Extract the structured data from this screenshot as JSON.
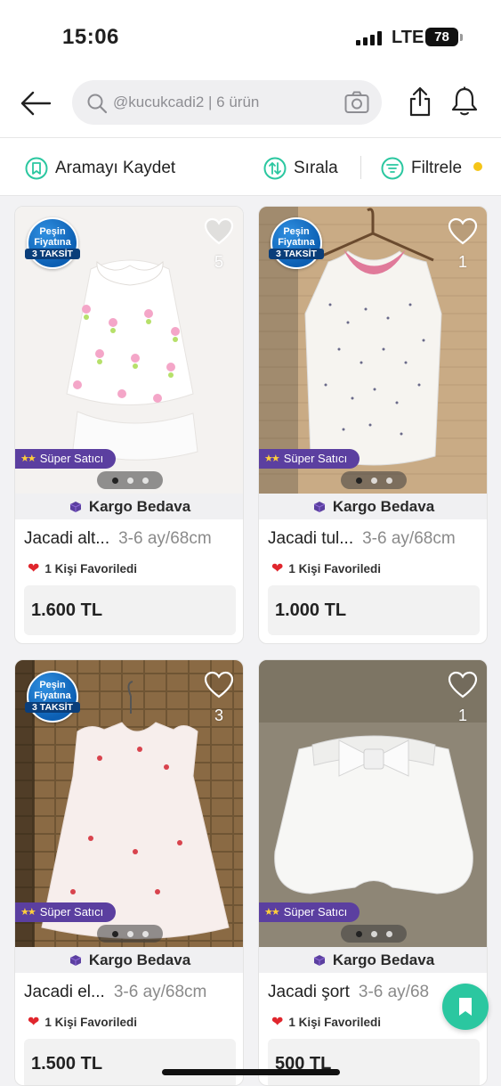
{
  "status_bar": {
    "time": "15:06",
    "network": "LTE",
    "battery": "78"
  },
  "header": {
    "search_placeholder": "@kucukcadi2 | 6 ürün"
  },
  "toolbar": {
    "save_search": "Aramayı Kaydet",
    "sort": "Sırala",
    "filter": "Filtrele"
  },
  "badges": {
    "taksit_line1": "Peşin",
    "taksit_line2": "Fiyatına",
    "taksit_line3": "3 TAKSİT",
    "super_seller": "Süper Satıcı",
    "free_shipping": "Kargo Bedava"
  },
  "products": [
    {
      "title": "Jacadi alt...",
      "size": "3-6 ay/68cm",
      "likes": "1 Kişi Favoriledi",
      "price": "1.600 TL",
      "fav_count": "5",
      "taksit_badge": true
    },
    {
      "title": "Jacadi tul...",
      "size": "3-6 ay/68cm",
      "likes": "1 Kişi Favoriledi",
      "price": "1.000 TL",
      "fav_count": "1",
      "taksit_badge": true
    },
    {
      "title": "Jacadi el...",
      "size": "3-6 ay/68cm",
      "likes": "1 Kişi Favoriledi",
      "price": "1.500 TL",
      "fav_count": "3",
      "taksit_badge": true
    },
    {
      "title": "Jacadi şort",
      "size": "3-6 ay/68",
      "likes": "1 Kişi Favoriledi",
      "price": "500 TL",
      "fav_count": "1",
      "taksit_badge": false
    }
  ],
  "colors": {
    "accent": "#2bc7a0",
    "super_seller": "#5b3fa0",
    "taksit_blue": "#0c5fb3",
    "filter_dot": "#f5c518"
  }
}
